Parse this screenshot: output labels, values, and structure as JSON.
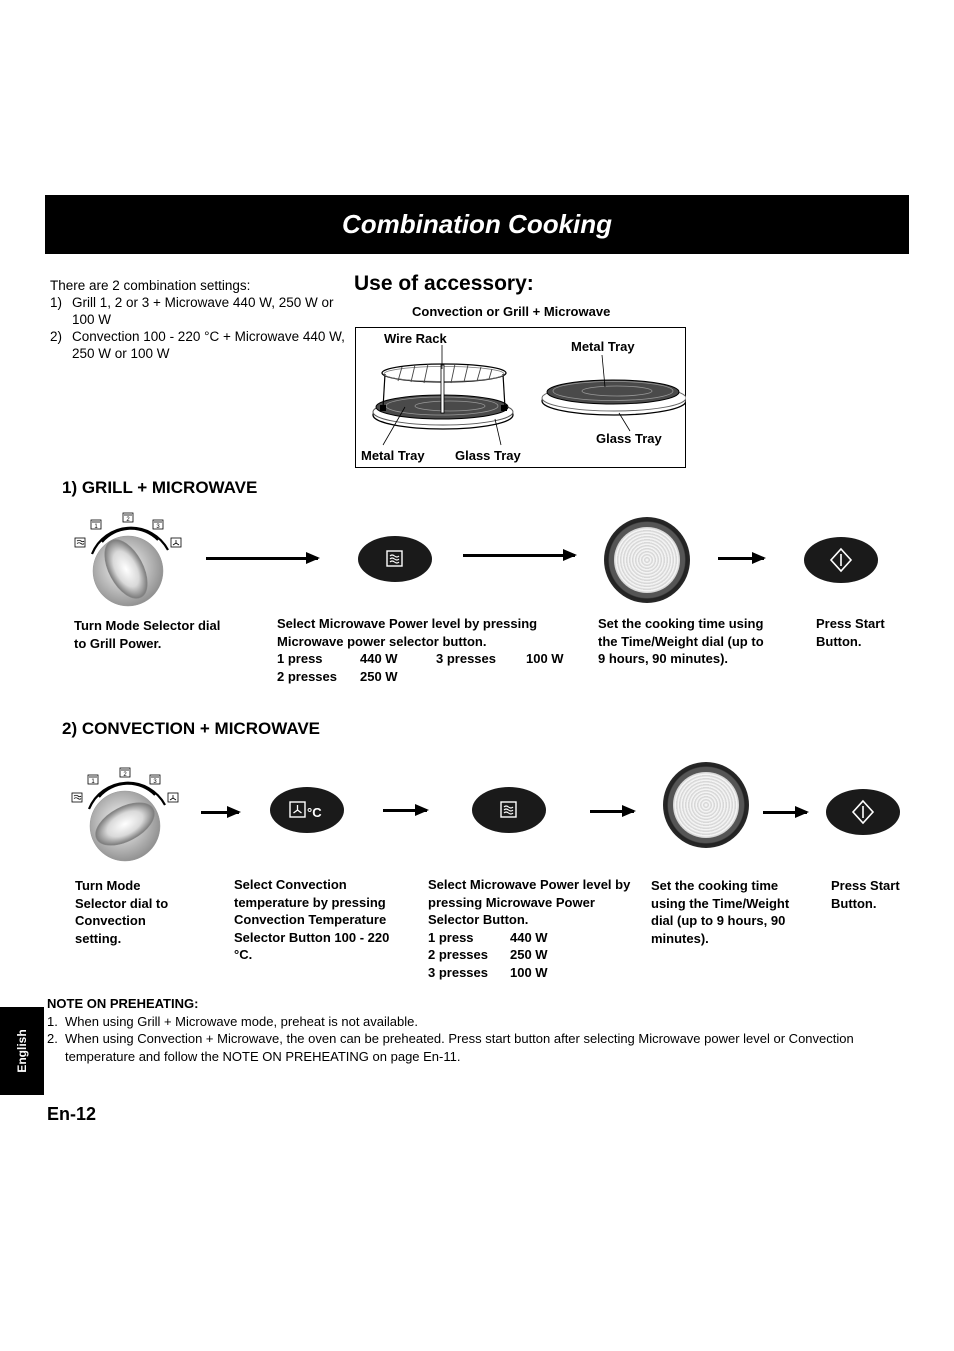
{
  "header": {
    "title": "Combination Cooking"
  },
  "intro": {
    "lead": "There are 2 combination settings:",
    "items": [
      {
        "num": "1)",
        "text": "Grill 1, 2 or 3 + Microwave 440 W, 250 W or 100 W"
      },
      {
        "num": "2)",
        "text": "Convection 100 - 220 °C + Microwave 440 W, 250 W or 100 W"
      }
    ]
  },
  "accessory": {
    "title": "Use of accessory:",
    "subtitle": "Convection or Grill + Microwave",
    "labels": {
      "wire_rack": "Wire Rack",
      "metal_tray_left": "Metal Tray",
      "glass_tray_left": "Glass Tray",
      "metal_tray_right": "Metal Tray",
      "glass_tray_right": "Glass Tray"
    }
  },
  "section1": {
    "heading": "1) GRILL + MICROWAVE",
    "dial_marks": [
      "1",
      "2",
      "3"
    ],
    "steps": [
      {
        "text": "Turn Mode Selector dial to Grill Power."
      },
      {
        "text": "Select Microwave Power level by pressing Microwave power selector button.",
        "table": [
          {
            "press": "1 press",
            "watt": "440 W",
            "press2": "3 presses",
            "watt2": "100 W"
          },
          {
            "press": "2 presses",
            "watt": "250 W"
          }
        ]
      },
      {
        "text": "Set the cooking time using the Time/Weight dial (up to 9 hours, 90 minutes)."
      },
      {
        "text": "Press Start Button."
      }
    ]
  },
  "section2": {
    "heading": "2) CONVECTION + MICROWAVE",
    "dial_marks": [
      "1",
      "2",
      "3"
    ],
    "conv_button_unit": "°C",
    "steps": [
      {
        "text": "Turn Mode Selector dial to Convection setting."
      },
      {
        "text": "Select Convection temperature by pressing Convection Temperature Selector Button 100 - 220 °C."
      },
      {
        "text": "Select Microwave Power level by pressing Microwave Power Selector Button.",
        "table": [
          {
            "press": "1 press",
            "watt": "440 W"
          },
          {
            "press": "2 presses",
            "watt": "250 W"
          },
          {
            "press": "3 presses",
            "watt": "100 W"
          }
        ]
      },
      {
        "text": "Set the cooking time using the Time/Weight dial (up to 9 hours, 90 minutes)."
      },
      {
        "text": "Press Start Button."
      }
    ]
  },
  "note": {
    "heading": "NOTE ON PREHEATING:",
    "items": [
      {
        "num": "1.",
        "text": "When using Grill + Microwave mode, preheat is not available."
      },
      {
        "num": "2.",
        "text": "When using Convection + Microwave, the oven can be preheated. Press start button after selecting Microwave power level or Convection temperature and follow the NOTE ON PREHEATING on page En-11."
      }
    ]
  },
  "side_tab": "English",
  "page_number": "En-12"
}
